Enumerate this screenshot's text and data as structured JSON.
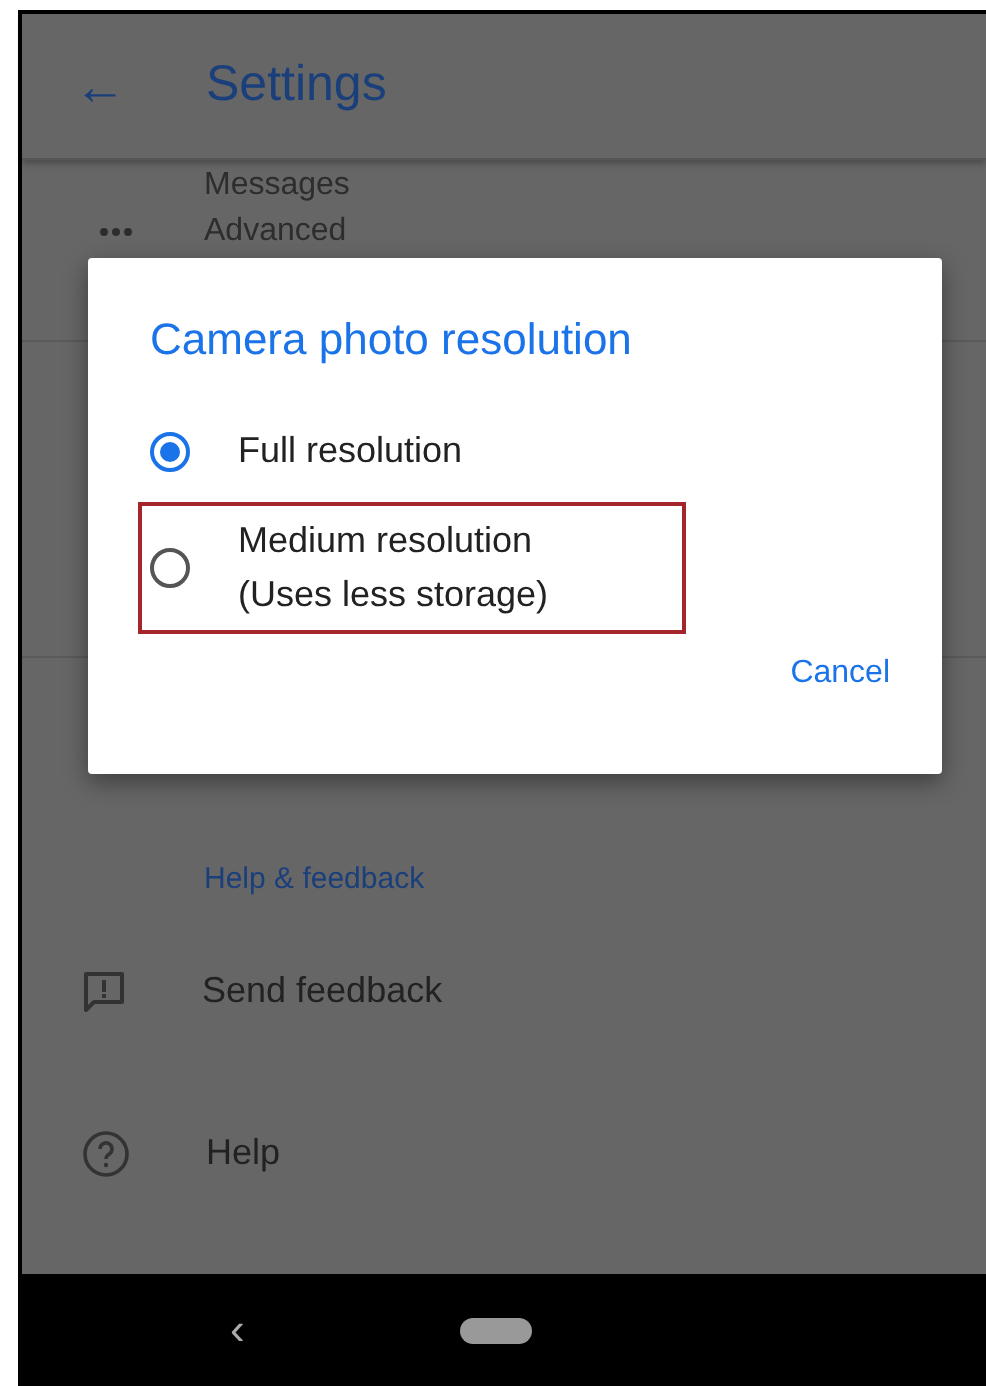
{
  "app_bar": {
    "back": "←",
    "title": "Settings"
  },
  "list_above": [
    {
      "kind": "plain",
      "text": "Messages"
    },
    {
      "kind": "overflow",
      "text": "Advanced"
    }
  ],
  "dialog": {
    "title": "Camera photo resolution",
    "options": [
      {
        "lines": [
          "Full resolution"
        ],
        "selected": true,
        "highlighted": false
      },
      {
        "lines": [
          "Medium resolution",
          "(Uses less storage)"
        ],
        "selected": false,
        "highlighted": true
      }
    ],
    "buttons": [
      "Cancel"
    ]
  },
  "section_header": "Help & feedback",
  "items": [
    {
      "kind": "feedback",
      "text": "Send feedback"
    },
    {
      "kind": "help",
      "text": "Help"
    }
  ],
  "nav_bar": {
    "back": "‹"
  }
}
